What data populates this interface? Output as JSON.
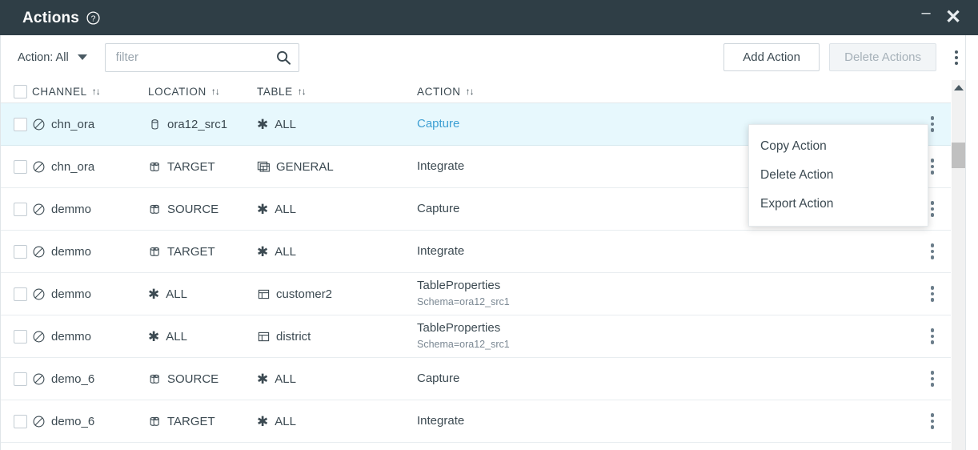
{
  "window": {
    "title": "Actions",
    "help_icon": "question-circle-icon",
    "minimize_label": "–",
    "close_label": "✕"
  },
  "toolbar": {
    "action_filter_label": "Action: All",
    "dropdown_icon": "chevron-down-icon",
    "search_placeholder": "filter",
    "search_value": "",
    "search_icon": "search-icon",
    "add_action_label": "Add Action",
    "delete_actions_label": "Delete Actions",
    "delete_actions_disabled": true,
    "overflow_icon": "kebab-menu-icon"
  },
  "table": {
    "columns": [
      {
        "key": "channel",
        "label": "CHANNEL",
        "sort_icon": "↑↓"
      },
      {
        "key": "location",
        "label": "LOCATION",
        "sort_icon": "↑↓"
      },
      {
        "key": "table",
        "label": "TABLE",
        "sort_icon": "↑↓"
      },
      {
        "key": "action",
        "label": "ACTION",
        "sort_icon": "↑↓"
      }
    ],
    "rows": [
      {
        "selected": true,
        "checked": false,
        "channel": "chn_ora",
        "channel_icon": "channel-icon",
        "location": "ora12_src1",
        "location_icon": "database-single-icon",
        "table": "ALL",
        "table_icon": "asterisk-icon",
        "action": "Capture",
        "action_sub": "",
        "action_is_link": true
      },
      {
        "selected": false,
        "checked": false,
        "channel": "chn_ora",
        "channel_icon": "channel-icon",
        "location": "TARGET",
        "location_icon": "database-stack-icon",
        "table": "GENERAL",
        "table_icon": "table-stack-icon",
        "action": "Integrate",
        "action_sub": "",
        "action_is_link": false
      },
      {
        "selected": false,
        "checked": false,
        "channel": "demmo",
        "channel_icon": "channel-icon",
        "location": "SOURCE",
        "location_icon": "database-stack-icon",
        "table": "ALL",
        "table_icon": "asterisk-icon",
        "action": "Capture",
        "action_sub": "",
        "action_is_link": false
      },
      {
        "selected": false,
        "checked": false,
        "channel": "demmo",
        "channel_icon": "channel-icon",
        "location": "TARGET",
        "location_icon": "database-stack-icon",
        "table": "ALL",
        "table_icon": "asterisk-icon",
        "action": "Integrate",
        "action_sub": "",
        "action_is_link": false
      },
      {
        "selected": false,
        "checked": false,
        "channel": "demmo",
        "channel_icon": "channel-icon",
        "location": "ALL",
        "location_icon": "asterisk-icon",
        "table": "customer2",
        "table_icon": "table-single-icon",
        "action": "TableProperties",
        "action_sub": "Schema=ora12_src1",
        "action_is_link": false
      },
      {
        "selected": false,
        "checked": false,
        "channel": "demmo",
        "channel_icon": "channel-icon",
        "location": "ALL",
        "location_icon": "asterisk-icon",
        "table": "district",
        "table_icon": "table-single-icon",
        "action": "TableProperties",
        "action_sub": "Schema=ora12_src1",
        "action_is_link": false
      },
      {
        "selected": false,
        "checked": false,
        "channel": "demo_6",
        "channel_icon": "channel-icon",
        "location": "SOURCE",
        "location_icon": "database-stack-icon",
        "table": "ALL",
        "table_icon": "asterisk-icon",
        "action": "Capture",
        "action_sub": "",
        "action_is_link": false
      },
      {
        "selected": false,
        "checked": false,
        "channel": "demo_6",
        "channel_icon": "channel-icon",
        "location": "TARGET",
        "location_icon": "database-stack-icon",
        "table": "ALL",
        "table_icon": "asterisk-icon",
        "action": "Integrate",
        "action_sub": "",
        "action_is_link": false
      }
    ]
  },
  "context_menu": {
    "visible": true,
    "items": [
      {
        "label": "Copy Action"
      },
      {
        "label": "Delete Action"
      },
      {
        "label": "Export Action"
      }
    ]
  },
  "scrollbar": {
    "up_arrow_icon": "caret-up-icon",
    "thumb_position": "near-top"
  },
  "colors": {
    "titlebar_bg": "#2f3e46",
    "selected_row_bg": "#e7f8fd",
    "link": "#3d9fd3",
    "text": "#3c4a52",
    "muted": "#7b8893"
  }
}
